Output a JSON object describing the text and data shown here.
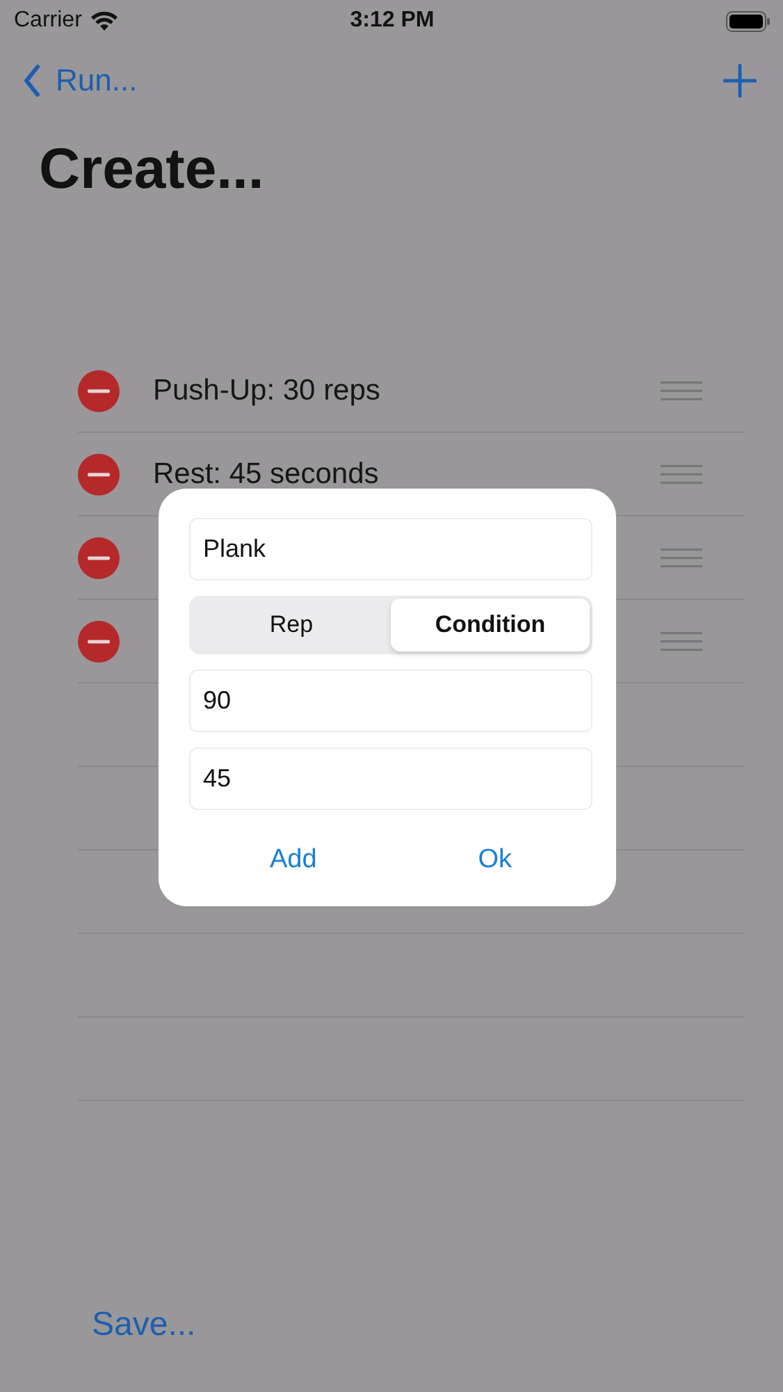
{
  "status_bar": {
    "carrier": "Carrier",
    "time": "3:12 PM"
  },
  "nav": {
    "back_label": "Run..."
  },
  "title": "Create...",
  "rows": [
    {
      "label": "Push-Up: 30 reps"
    },
    {
      "label": "Rest: 45 seconds"
    },
    {},
    {}
  ],
  "save": "Save...",
  "dialog": {
    "name_value": "Plank",
    "segments": [
      {
        "label": "Rep",
        "selected": false
      },
      {
        "label": "Condition",
        "selected": true
      }
    ],
    "fields": [
      {
        "value": "90"
      },
      {
        "value": "45"
      }
    ],
    "buttons": [
      "Add",
      "Ok"
    ]
  }
}
